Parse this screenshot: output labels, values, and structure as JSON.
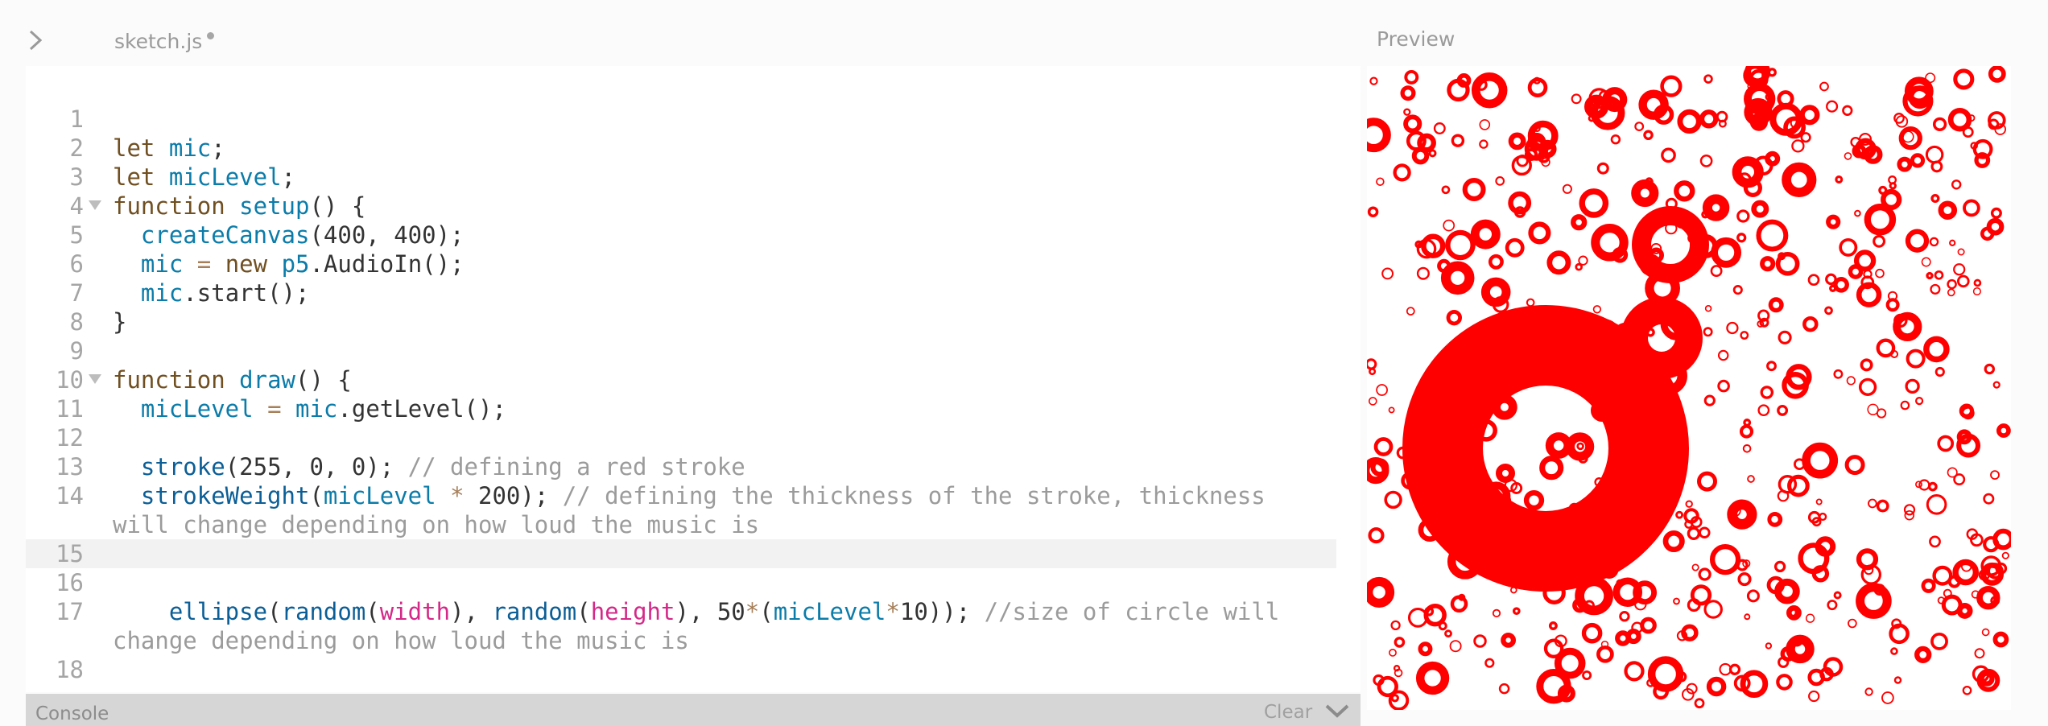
{
  "editor": {
    "file_name": "sketch.js",
    "lines": [
      "1",
      "2",
      "3",
      "4",
      "5",
      "6",
      "7",
      "8",
      "9",
      "10",
      "11",
      "12",
      "13",
      "14",
      "15",
      "16",
      "17",
      "18"
    ],
    "code": {
      "l2": [
        "let",
        "mic",
        ";"
      ],
      "l3": [
        "let",
        "micLevel",
        ";"
      ],
      "l4": [
        "function",
        "setup",
        "() {"
      ],
      "l5": [
        "createCanvas",
        "(400, 400);"
      ],
      "l6": [
        "mic",
        "=",
        "new",
        "p5",
        ".AudioIn();"
      ],
      "l7": [
        "mic",
        ".start();"
      ],
      "l8": "}",
      "l10": [
        "function",
        "draw",
        "() {"
      ],
      "l11": [
        "micLevel",
        "=",
        "mic",
        ".getLevel();"
      ],
      "l13": [
        "stroke",
        "(255, 0, 0);",
        "// defining a red stroke"
      ],
      "l14": [
        "strokeWeight",
        "(",
        "micLevel",
        "*",
        "200);",
        "// defining the thickness of the stroke, thickness"
      ],
      "l14_cont": "will change depending on how loud the music is",
      "l17": [
        "ellipse",
        "(",
        "random",
        "(",
        "width",
        "), ",
        "random",
        "(",
        "height",
        "), 50",
        "*",
        "(",
        "micLevel",
        "*",
        "10)); ",
        "//size of circle will"
      ],
      "l17_cont": "change depending on how loud the music is"
    }
  },
  "preview": {
    "title": "Preview",
    "stroke_color": "#ff0000",
    "background": "#ffffff"
  },
  "console": {
    "title": "Console",
    "clear_label": "Clear"
  },
  "icons": {
    "sidebar_toggle": "chevron-right-icon",
    "console_toggle": "chevron-down-icon",
    "unsaved": "unsaved-dot-icon",
    "fold": "fold-arrow-icon"
  }
}
